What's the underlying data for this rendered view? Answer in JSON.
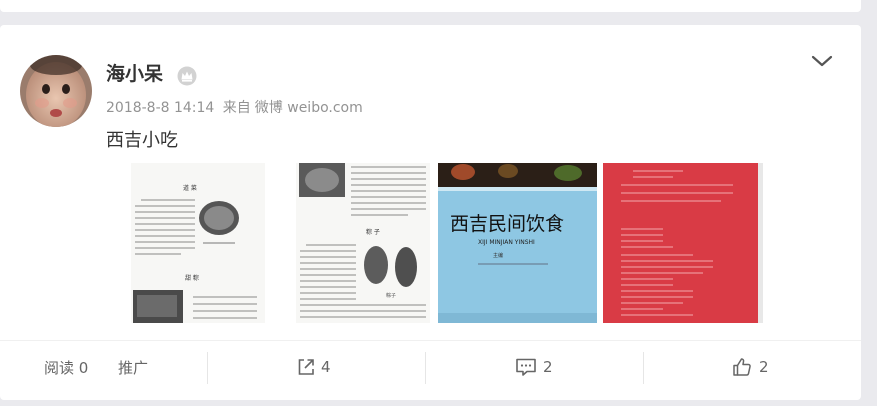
{
  "post": {
    "username": "海小呆",
    "timestamp": "2018-8-8 14:14",
    "source_prefix": "来自",
    "source": "微博 weibo.com",
    "text": "西吉小吃"
  },
  "images": [
    {
      "type": "book-page-scan",
      "heading_a": "道 菜",
      "heading_b": "甜 粽"
    },
    {
      "type": "book-page-scan",
      "heading": "粽 子",
      "caption": "粽子"
    },
    {
      "type": "book-cover",
      "title": "西吉民间饮食",
      "pinyin": "XIJI MINJIAN YINSHI",
      "authors": "主编  ",
      "cover_color": "#8ec7e3"
    },
    {
      "type": "red-copyright-page",
      "cover_color": "#d93b45"
    }
  ],
  "toolbar": {
    "read_label": "阅读 0",
    "promote_label": "推广",
    "share_count": "4",
    "comment_count": "2",
    "like_count": "2"
  },
  "icons": {
    "avatar": "baby-photo",
    "badge": "crown-icon",
    "menu": "chevron-down-icon",
    "share": "share-icon",
    "comment": "comment-icon",
    "like": "thumbs-up-icon"
  }
}
